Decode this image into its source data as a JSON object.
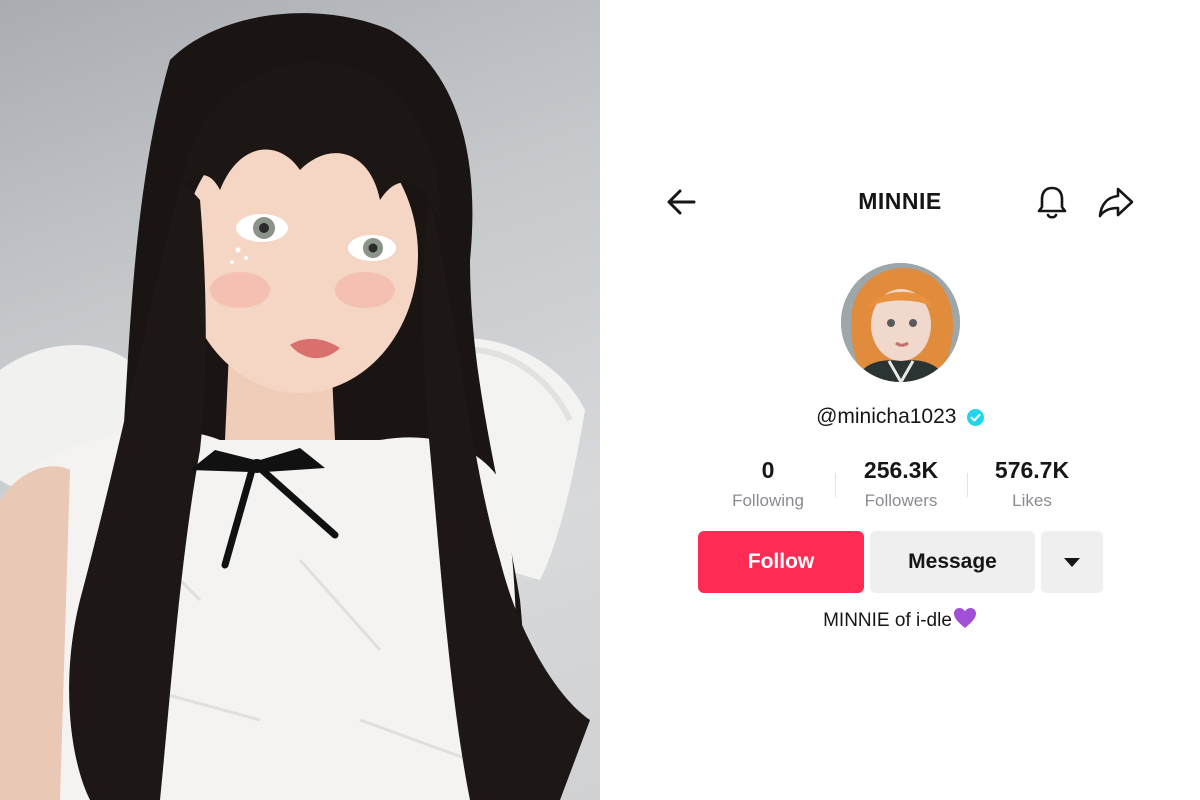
{
  "header": {
    "title": "MINNIE",
    "back_icon": "arrow-left-icon",
    "bell_icon": "bell-icon",
    "share_icon": "share-arrow-icon"
  },
  "profile": {
    "username": "@minicha1023",
    "verified_icon": "verified-check-icon",
    "verified_color": "#20d5ec",
    "bio": "MINNIE of i-dle",
    "bio_emoji": "purple-heart-icon"
  },
  "stats": [
    {
      "value": "0",
      "label": "Following"
    },
    {
      "value": "256.3K",
      "label": "Followers"
    },
    {
      "value": "576.7K",
      "label": "Likes"
    }
  ],
  "actions": {
    "follow_label": "Follow",
    "message_label": "Message",
    "more_icon": "caret-down-icon"
  },
  "colors": {
    "accent": "#fe2c55",
    "secondary_button": "#efeff0",
    "text": "#161616",
    "muted": "#8a8b91"
  }
}
